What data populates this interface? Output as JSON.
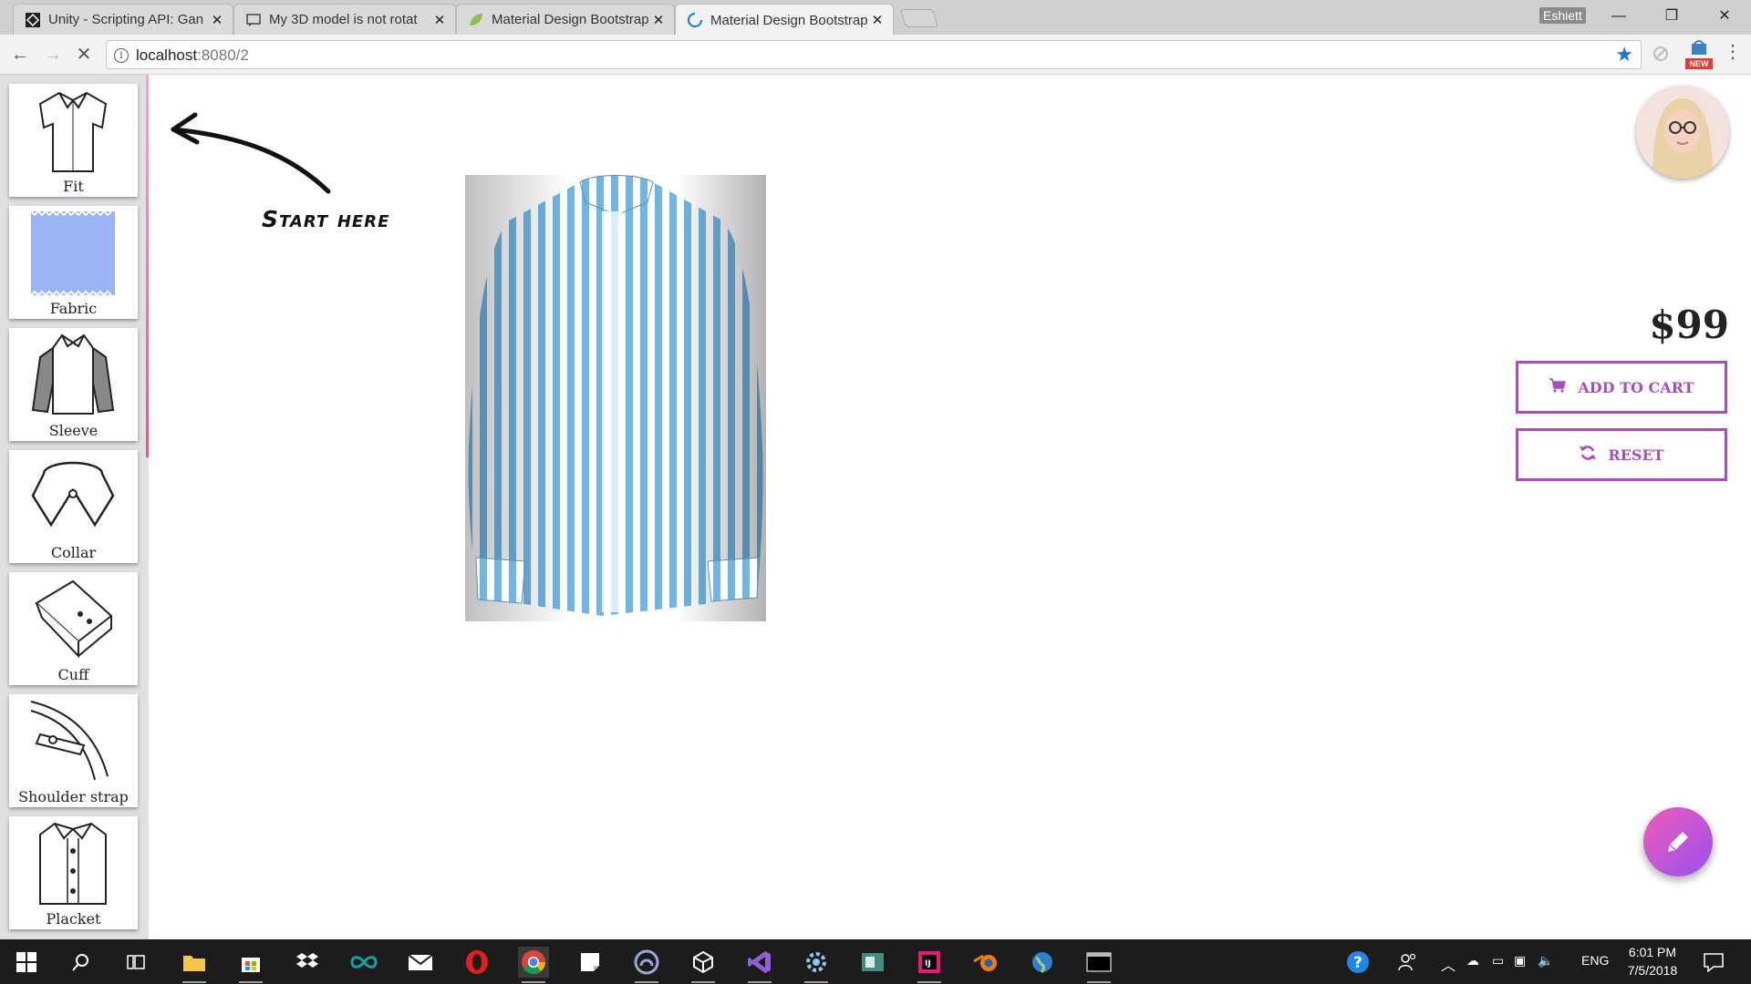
{
  "browser": {
    "tabs": [
      {
        "title": "Unity - Scripting API: Gan",
        "favicon": "unity-icon",
        "active": false
      },
      {
        "title": "My 3D model is not rotat",
        "favicon": "forum-icon",
        "active": false
      },
      {
        "title": "Material Design Bootstrap",
        "favicon": "leaf-icon",
        "active": false
      },
      {
        "title": "Material Design Bootstrap",
        "favicon": "loading-spinner-icon",
        "active": true
      }
    ],
    "profile_name": "Eshiett",
    "url_host": "localhost",
    "url_rest": ":8080/2",
    "new_badge": "NEW"
  },
  "sidebar": {
    "items": [
      {
        "label": "Fit",
        "icon": "shirt-fit-icon"
      },
      {
        "label": "Fabric",
        "icon": "fabric-swatch-icon"
      },
      {
        "label": "Sleeve",
        "icon": "sleeve-icon"
      },
      {
        "label": "Collar",
        "icon": "collar-icon"
      },
      {
        "label": "Cuff",
        "icon": "cuff-icon"
      },
      {
        "label": "Shoulder strap",
        "icon": "shoulder-strap-icon"
      },
      {
        "label": "Placket",
        "icon": "placket-icon"
      }
    ]
  },
  "hint": {
    "text": "Start here"
  },
  "product": {
    "price": "$99",
    "add_to_cart_label": "ADD TO CART",
    "reset_label": "RESET"
  },
  "colors": {
    "accent": "#a64ec0",
    "fab_start": "#ee5db8",
    "fab_end": "#9a4ff0",
    "stripe_blue": "#6fb6e6"
  },
  "taskbar": {
    "language": "ENG",
    "time": "6:01 PM",
    "date": "7/5/2018"
  }
}
